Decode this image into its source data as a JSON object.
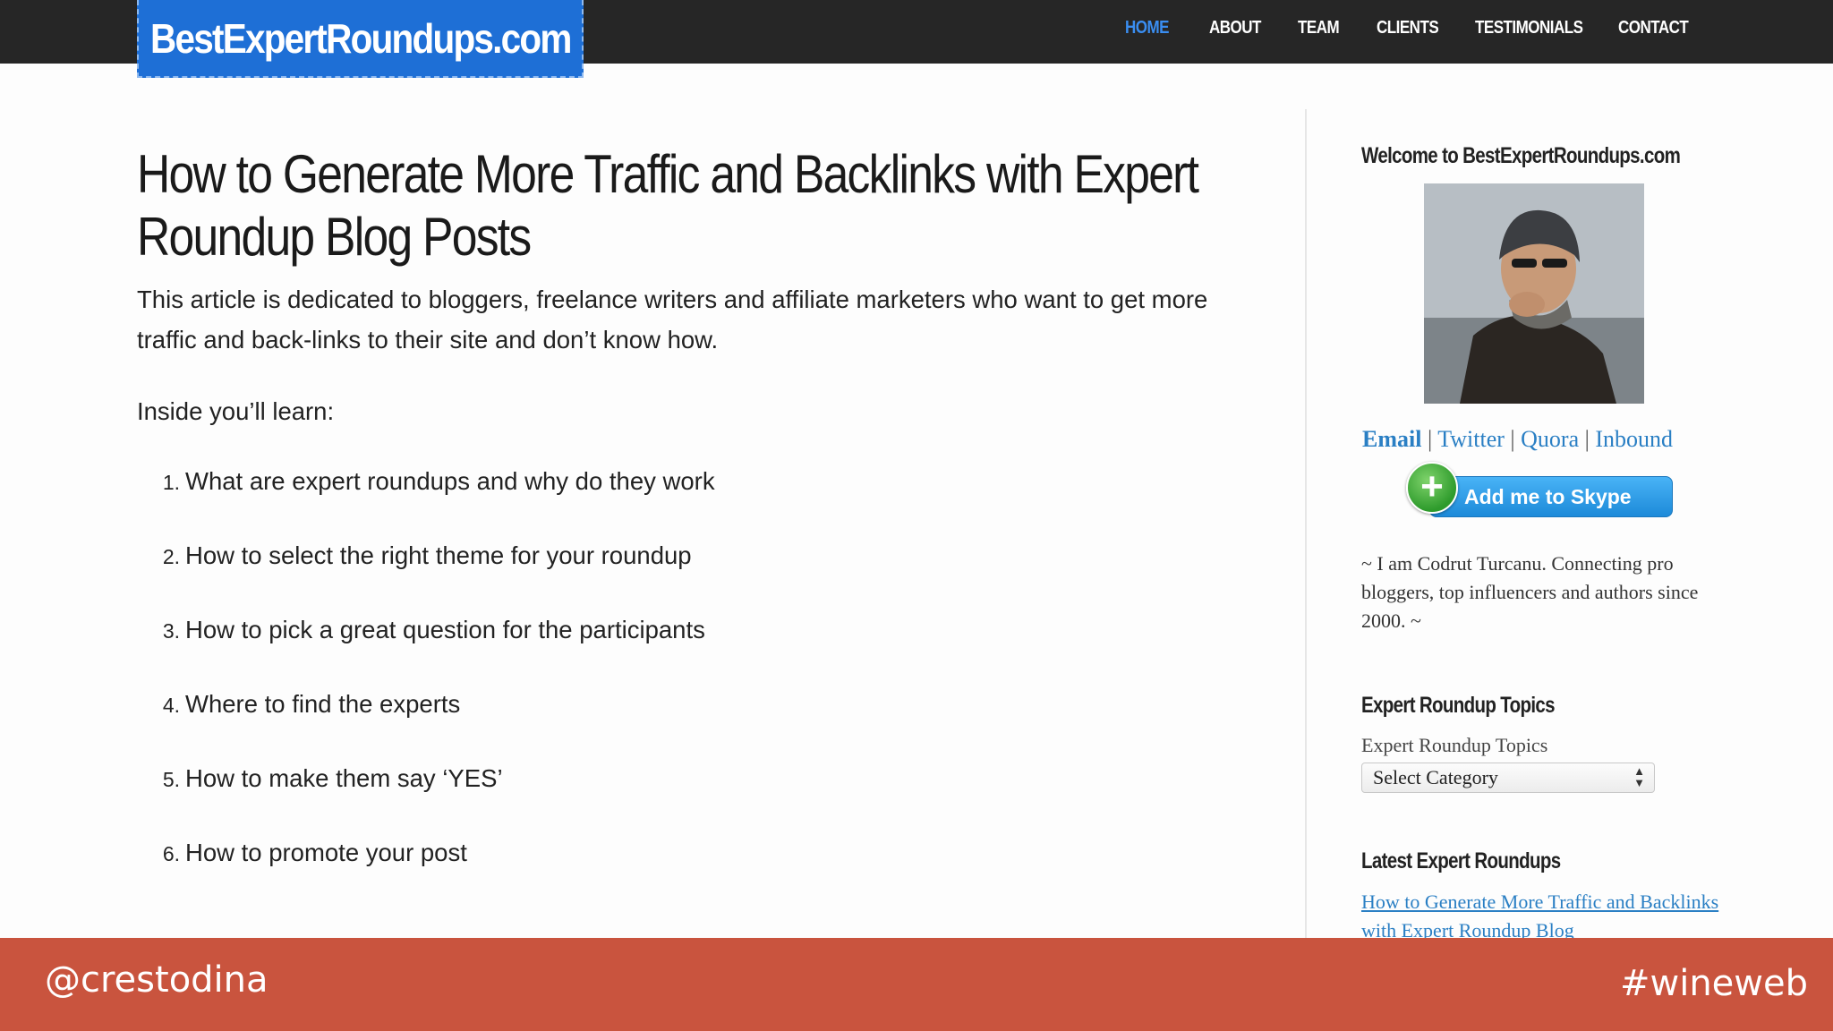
{
  "site": {
    "logo": "BestExpertRoundups.com",
    "nav": [
      "HOME",
      "ABOUT",
      "TEAM",
      "CLIENTS",
      "TESTIMONIALS",
      "CONTACT"
    ],
    "active_nav": "HOME"
  },
  "article": {
    "title": "How to Generate More Traffic and Backlinks with Expert Roundup Blog Posts",
    "intro": "This article is dedicated to bloggers, freelance writers and affiliate marketers who want to get more traffic and back-links to their site and don’t know how.",
    "inside_label": "Inside you’ll learn:",
    "list": [
      {
        "num": "1.",
        "text": "What are expert roundups and why do they work"
      },
      {
        "num": "2.",
        "text": "How to select the right theme for your roundup"
      },
      {
        "num": "3.",
        "text": "How to pick a great question for the participants"
      },
      {
        "num": "4.",
        "text": "Where to find the experts"
      },
      {
        "num": "5.",
        "text": "How to make them say ‘YES’"
      },
      {
        "num": "6.",
        "text": "How to promote your post"
      }
    ]
  },
  "sidebar": {
    "welcome_heading": "Welcome to BestExpertRoundups.com",
    "links": {
      "email": "Email",
      "twitter": "Twitter",
      "quora": "Quora",
      "inbound": "Inbound",
      "separator": "|"
    },
    "skype_button": "Add me to Skype",
    "bio": "~ I am Codrut Turcanu. Connecting pro bloggers, top influencers and authors since 2000. ~",
    "topics_heading": "Expert Roundup Topics",
    "topics_label": "Expert Roundup Topics",
    "select_value": "Select Category",
    "latest_heading": "Latest Expert Roundups",
    "latest_link": "How to Generate More Traffic and Backlinks with Expert Roundup Blog"
  },
  "footer": {
    "handle": "@crestodina",
    "hashtag": "#wineweb"
  },
  "colors": {
    "nav_bg": "#262626",
    "logo_bg": "#1e6fd6",
    "nav_active": "#3a8ef2",
    "link": "#2a7fc4",
    "footer_bg": "#c9543e"
  }
}
